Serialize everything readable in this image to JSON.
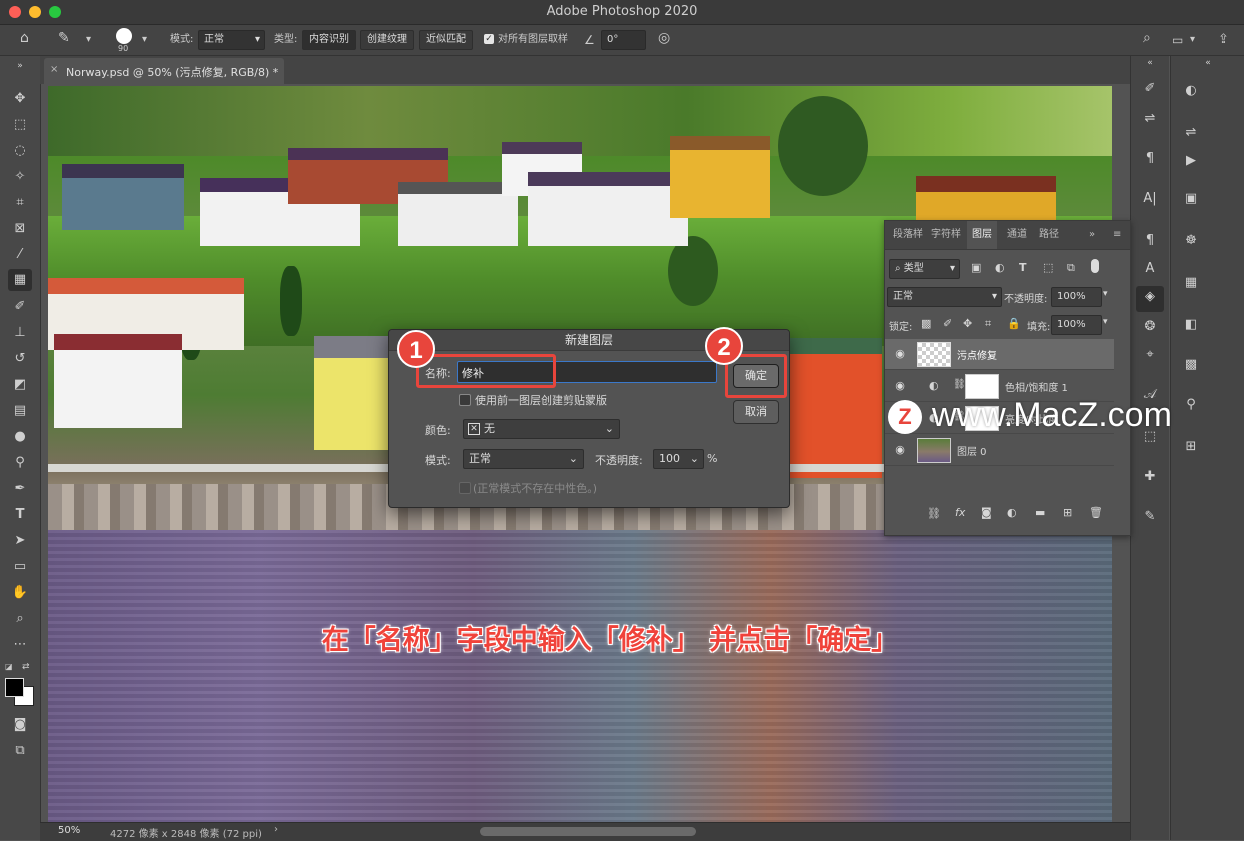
{
  "window": {
    "title": "Adobe Photoshop 2020"
  },
  "options_bar": {
    "brush_size": "90",
    "mode_label": "模式:",
    "mode_value": "正常",
    "type_label": "类型:",
    "type_buttons": [
      "内容识别",
      "创建纹理",
      "近似匹配"
    ],
    "sample_all_label": "对所有图层取样",
    "angle_value": "0°"
  },
  "document": {
    "tab_title": "Norway.psd @ 50% (污点修复, RGB/8) *",
    "close": "×"
  },
  "status_bar": {
    "zoom": "50%",
    "info": "4272 像素 x 2848 像素 (72 ppi)"
  },
  "layers_panel": {
    "tabs": [
      "段落样",
      "字符样",
      "图层",
      "通道",
      "路径"
    ],
    "active_tab": "图层",
    "filter_label": "类型",
    "blend_mode": "正常",
    "opacity_label": "不透明度:",
    "opacity_value": "100%",
    "lock_label": "锁定:",
    "fill_label": "填充:",
    "fill_value": "100%",
    "layers": [
      {
        "name": "污点修复",
        "selected": true
      },
      {
        "name": "色相/饱和度 1",
        "selected": false
      },
      {
        "name": "亮度/对比度 1",
        "selected": false
      },
      {
        "name": "图层 0",
        "selected": false
      }
    ]
  },
  "dialog": {
    "title": "新建图层",
    "name_label": "名称:",
    "name_value": "修补",
    "clip_checkbox_label": "使用前一图层创建剪贴蒙版",
    "color_label": "颜色:",
    "color_value": "无",
    "mode_label": "模式:",
    "mode_value": "正常",
    "opacity_label": "不透明度:",
    "opacity_value": "100",
    "percent": "%",
    "neutral_note": "(正常模式不存在中性色。)",
    "ok_label": "确定",
    "cancel_label": "取消"
  },
  "annotations": {
    "badge_1": "1",
    "badge_2": "2",
    "caption": "在「名称」字段中输入「修补」 并点击「确定」"
  },
  "watermark": {
    "text": "www.MacZ.com",
    "logo_letter": "Z"
  },
  "colors": {
    "accent_red": "#e8453c",
    "panel_bg": "#535353",
    "dark_bg": "#3a3a3a"
  }
}
